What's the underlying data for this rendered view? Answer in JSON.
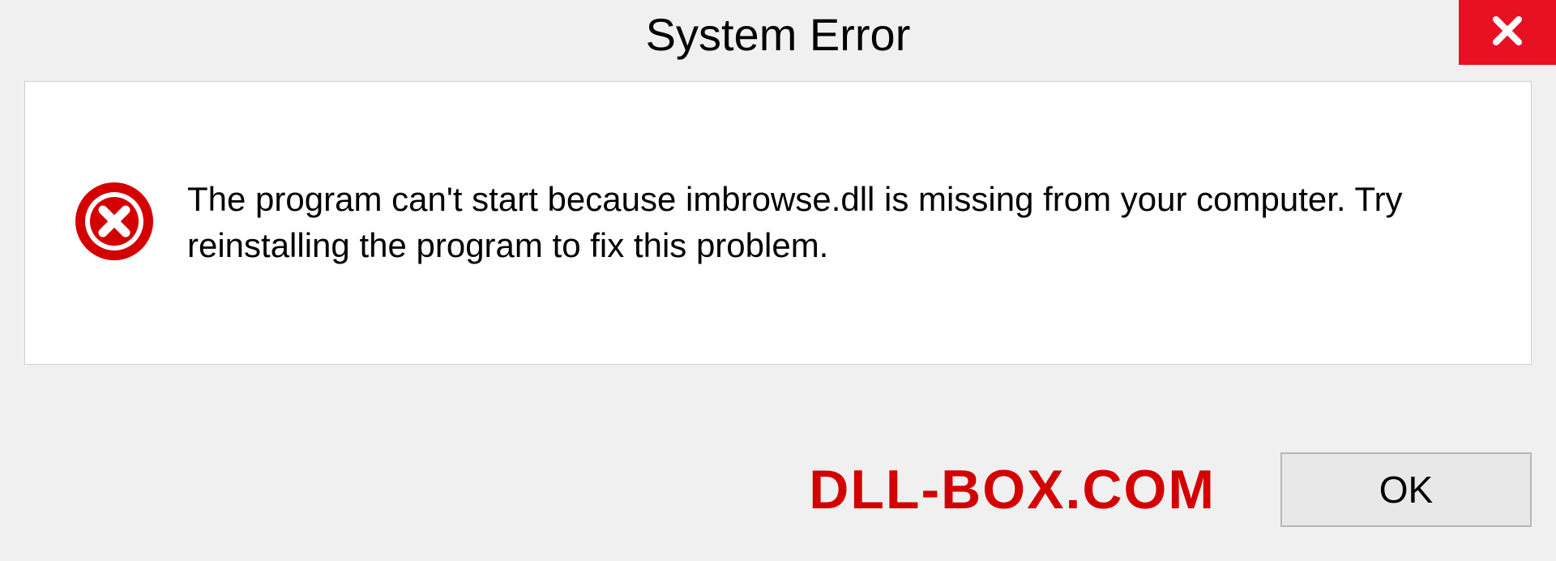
{
  "dialog": {
    "title": "System Error",
    "message": "The program can't start because imbrowse.dll is missing from your computer. Try reinstalling the program to fix this problem.",
    "ok_label": "OK"
  },
  "watermark": "DLL-BOX.COM",
  "colors": {
    "close_bg": "#e81123",
    "error_icon": "#d40000",
    "watermark": "#d40000"
  }
}
